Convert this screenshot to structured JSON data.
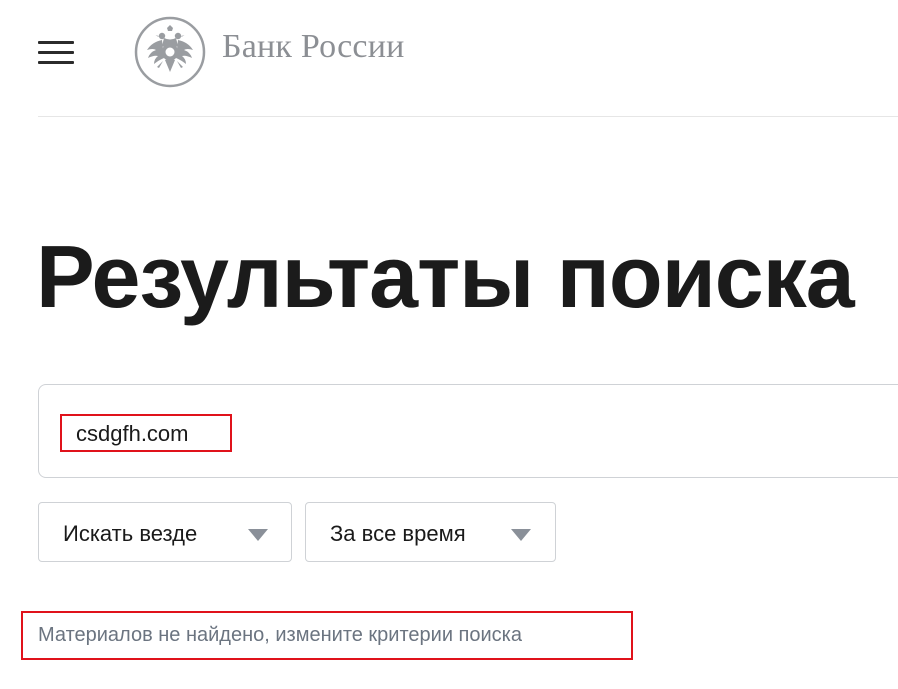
{
  "header": {
    "menu_icon": "hamburger-menu-icon",
    "logo_icon": "double-headed-eagle-emblem",
    "logo_text": "Банк России"
  },
  "main": {
    "title": "Результаты поиска",
    "search": {
      "value": "csdgfh.com"
    },
    "filters": [
      {
        "label": "Искать везде",
        "icon": "triangle-down-icon"
      },
      {
        "label": "За все время",
        "icon": "triangle-down-icon"
      }
    ],
    "status_text": "Материалов не найдено, измените критерии поиска"
  },
  "colors": {
    "highlight": "#e0121b",
    "logo_gray": "#8c8f94",
    "muted_text": "#6b7480",
    "border": "#cfd2d6"
  }
}
